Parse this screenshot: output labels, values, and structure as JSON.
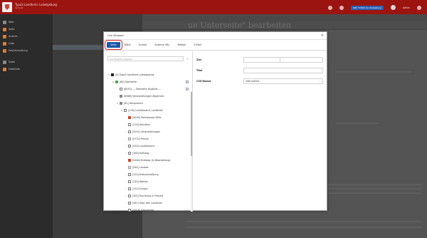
{
  "topbar": {
    "brand_title": "Typo3 Landkreis Ludwigsburg",
    "brand_sub": "12.4.10",
    "env_badge": "DEV TYPO3 12 Umstellung",
    "user": "Admin"
  },
  "dialog": {
    "title": "Link Browser",
    "close_glyph": "×",
    "tabs": [
      "Seite",
      "Datei",
      "Ordner",
      "Externe URL",
      "Telefon",
      "E-Mail"
    ],
    "search_placeholder": "Suchbegriff eingeben",
    "pin_glyph": "⊹",
    "tree": [
      {
        "label": "[0] Typo3 Landkreis Ludwigsburg",
        "indent": 0,
        "chev": "▾",
        "icon": "logo"
      },
      {
        "label": "[80] Startseite",
        "indent": 1,
        "chev": "▾",
        "icon": "site",
        "badge": true
      },
      {
        "label": "[6032] --- Startseite Duplikat ---",
        "indent": 2,
        "chev": "",
        "icon": "page",
        "badge": true
      },
      {
        "label": "[6368] Veranstaltungen Allgemein",
        "indent": 2,
        "chev": "›",
        "icon": "folder"
      },
      {
        "label": "[81] Hauptmenu",
        "indent": 2,
        "chev": "▾",
        "icon": "folder"
      },
      {
        "label": "[116] Landratsamt, Landkreis",
        "indent": 3,
        "chev": "▾",
        "icon": "page"
      },
      {
        "label": "[5039] Hochwasser-Hilfe",
        "indent": 4,
        "chev": "",
        "icon": "red"
      },
      {
        "label": "[118] Aktuelles",
        "indent": 4,
        "chev": "›",
        "icon": "page"
      },
      {
        "label": "[5241] Veranstaltungen",
        "indent": 4,
        "chev": "›",
        "icon": "page"
      },
      {
        "label": "[2732] Presse",
        "indent": 4,
        "chev": "›",
        "icon": "grid"
      },
      {
        "label": "[220] Landratsamt",
        "indent": 4,
        "chev": "›",
        "icon": "page"
      },
      {
        "label": "[190] Kreistag",
        "indent": 4,
        "chev": "›",
        "icon": "page"
      },
      {
        "label": "[5464] Kreistag (In Bearbeitung)",
        "indent": 4,
        "chev": "",
        "icon": "red"
      },
      {
        "label": "[264] Landrat",
        "indent": 4,
        "chev": "",
        "icon": "grid"
      },
      {
        "label": "[124] Kreisverwaltung",
        "indent": 4,
        "chev": "›",
        "icon": "page"
      },
      {
        "label": "[120] Wahlen",
        "indent": 4,
        "chev": "›",
        "icon": "page"
      },
      {
        "label": "[131] Europa",
        "indent": 4,
        "chev": "›",
        "icon": "page"
      },
      {
        "label": "[302] Tourismus & Freizeit",
        "indent": 4,
        "chev": "›",
        "icon": "page"
      },
      {
        "label": "[387] Über den Landkreis",
        "indent": 4,
        "chev": "›",
        "icon": "page"
      },
      {
        "label": "[1018] Geschichte",
        "indent": 4,
        "chev": "›",
        "icon": "page"
      }
    ],
    "fields": {
      "ziel_label": "Ziel",
      "titel_label": "Titel",
      "css_label": "CSS-Klasse",
      "css_value": "internalLink",
      "caret": "⌄"
    }
  },
  "background": {
    "heading": "ue Unterseite\" bearbeiten",
    "sidebar_items": [
      "Web",
      "Seite",
      "Ansicht",
      "Liste",
      "Info/Verwaltung",
      "Datei",
      "Dateiliste"
    ]
  },
  "colors": {
    "topbar": "#9c1410",
    "accent": "#1c58a8",
    "highlight": "#d61f1f"
  }
}
